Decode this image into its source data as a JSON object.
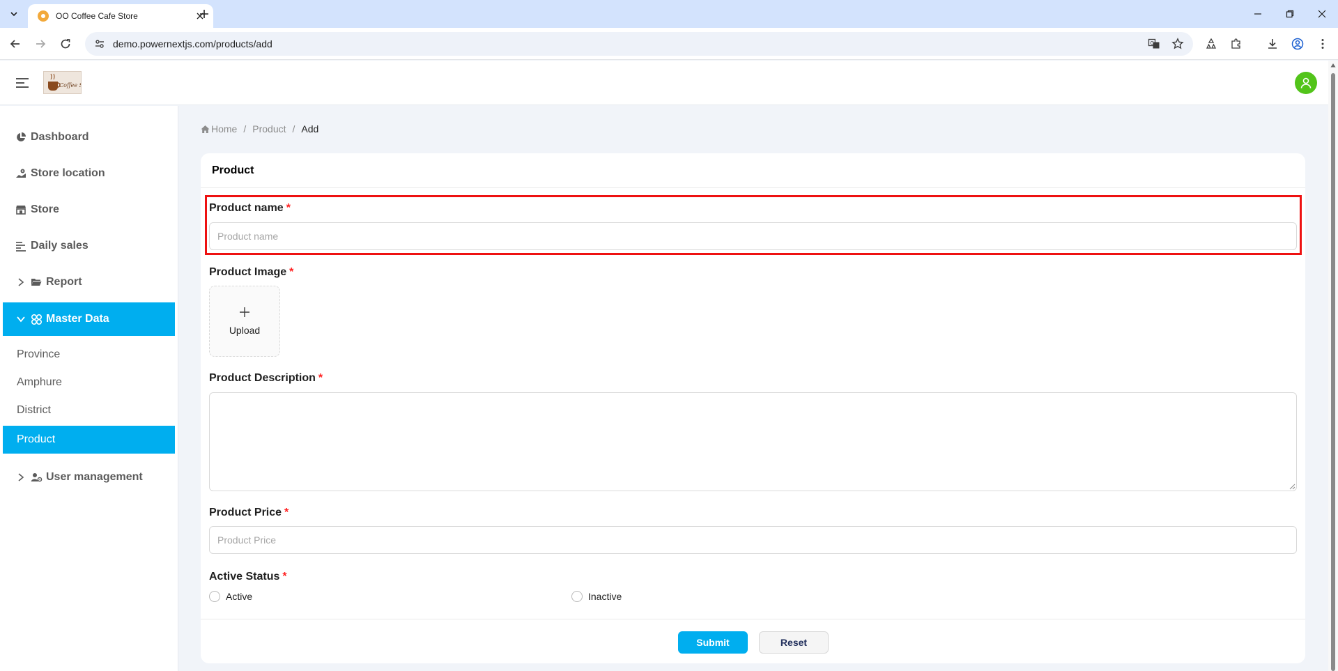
{
  "browser": {
    "tab_title": "OO Coffee Cafe Store",
    "url": "demo.powernextjs.com/products/add"
  },
  "header": {
    "logo_text": "Coffee Shop"
  },
  "sidebar": {
    "items": [
      {
        "label": "Dashboard",
        "icon": "pie-chart-icon"
      },
      {
        "label": "Store location",
        "icon": "map-location-icon"
      },
      {
        "label": "Store",
        "icon": "shop-icon"
      },
      {
        "label": "Daily sales",
        "icon": "bar-list-icon"
      },
      {
        "label": "Report",
        "icon": "folder-open-icon"
      },
      {
        "label": "Master Data",
        "icon": "database-icon"
      },
      {
        "label": "User management",
        "icon": "user-gear-icon"
      }
    ],
    "master_data_children": [
      {
        "label": "Province"
      },
      {
        "label": "Amphure"
      },
      {
        "label": "District"
      },
      {
        "label": "Product"
      }
    ]
  },
  "breadcrumb": {
    "home": "Home",
    "section": "Product",
    "current": "Add",
    "separator": "/"
  },
  "form": {
    "card_title": "Product",
    "product_name": {
      "label": "Product name",
      "placeholder": "Product name",
      "value": ""
    },
    "product_image": {
      "label": "Product Image",
      "upload_label": "Upload"
    },
    "product_description": {
      "label": "Product Description",
      "value": ""
    },
    "product_price": {
      "label": "Product Price",
      "placeholder": "Product Price",
      "value": ""
    },
    "active_status": {
      "label": "Active Status",
      "options": [
        "Active",
        "Inactive"
      ],
      "selected": null
    },
    "required_mark": "*",
    "submit_label": "Submit",
    "reset_label": "Reset"
  },
  "colors": {
    "accent": "#00aeef",
    "avatar": "#52c41a",
    "required": "#ff2020",
    "highlight": "#ee1111",
    "tabbar": "#d3e3fd"
  }
}
